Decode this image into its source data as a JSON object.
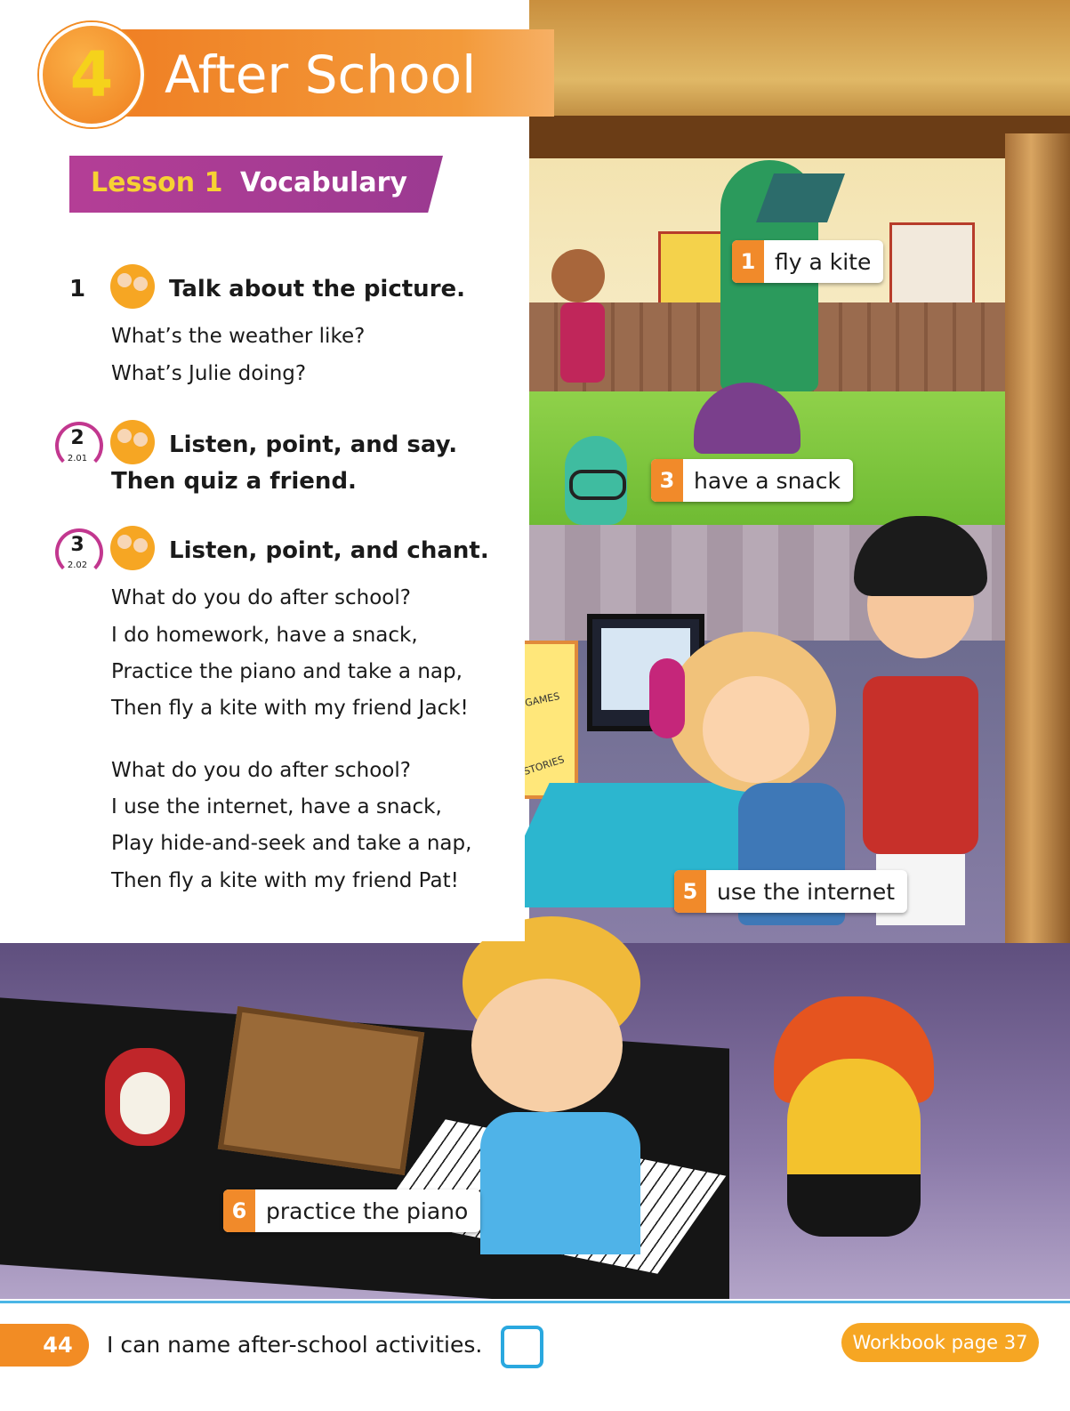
{
  "unit": {
    "number": "4",
    "title": "After School"
  },
  "lesson": {
    "label": "Lesson 1",
    "topic": "Vocabulary"
  },
  "exercises": [
    {
      "number": "1",
      "title": "Talk about the picture.",
      "lines": [
        "What’s the weather like?",
        "What’s Julie doing?"
      ]
    },
    {
      "number": "2",
      "track": "2.01",
      "title_line1": "Listen, point, and say.",
      "title_line2": "Then quiz a friend."
    },
    {
      "number": "3",
      "track": "2.02",
      "title": "Listen, point, and chant.",
      "verse1": [
        "What do you do after school?",
        "I do homework, have a snack,",
        "Practice the piano and take a nap,",
        "Then fly a kite with my friend Jack!"
      ],
      "verse2": [
        "What do you do after school?",
        "I use the internet, have a snack,",
        "Play hide-and-seek and take a nap,",
        "Then fly a kite with my friend Pat!"
      ]
    }
  ],
  "vocab_labels": [
    {
      "number": "1",
      "text": "fly a kite"
    },
    {
      "number": "3",
      "text": "have a snack"
    },
    {
      "number": "5",
      "text": "use the internet"
    },
    {
      "number": "6",
      "text": "practice the piano"
    }
  ],
  "illustration_text": {
    "poster_games": "GAMES",
    "poster_stories": "STORIES"
  },
  "footer": {
    "page_number": "44",
    "can_do": "I can name after-school activities.",
    "workbook": "Workbook page 37"
  },
  "colors": {
    "accent_orange": "#f28c24",
    "lesson_purple": "#a63b93",
    "lesson_yellow": "#f7d233",
    "checkbox_blue": "#2aa8df"
  }
}
